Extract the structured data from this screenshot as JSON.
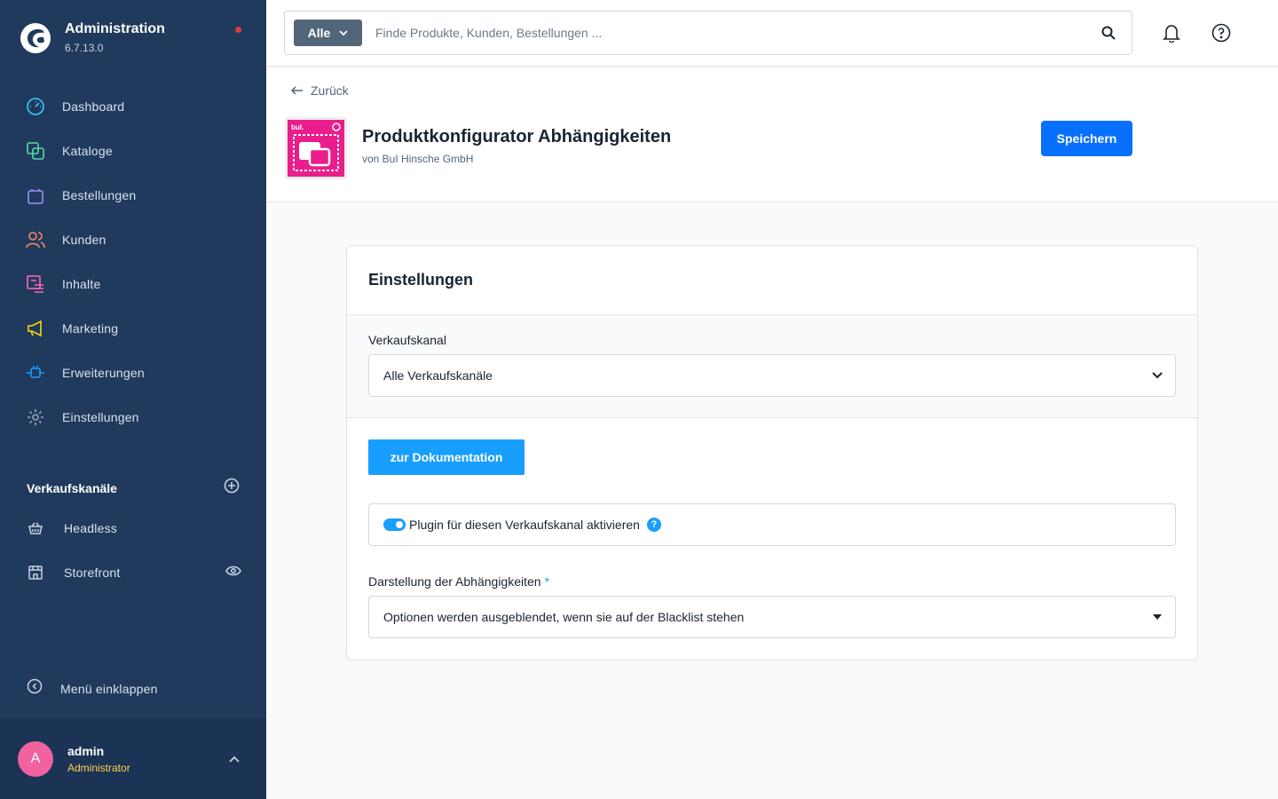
{
  "sidebar": {
    "brand_title": "Administration",
    "brand_version": "6.7.13.0",
    "nav": [
      {
        "label": "Dashboard",
        "icon": "dashboard-icon",
        "color": "#3ec8ff"
      },
      {
        "label": "Kataloge",
        "icon": "catalog-icon",
        "color": "#57d9a3"
      },
      {
        "label": "Bestellungen",
        "icon": "shopping-bag-icon",
        "color": "#a092f0"
      },
      {
        "label": "Kunden",
        "icon": "users-icon",
        "color": "#f88962"
      },
      {
        "label": "Inhalte",
        "icon": "content-icon",
        "color": "#ff68b4"
      },
      {
        "label": "Marketing",
        "icon": "megaphone-icon",
        "color": "#ffd700"
      },
      {
        "label": "Erweiterungen",
        "icon": "plug-icon",
        "color": "#189eff"
      },
      {
        "label": "Einstellungen",
        "icon": "gear-icon",
        "color": "#9aa8b5"
      }
    ],
    "sales_channels_title": "Verkaufskanäle",
    "sales_channels": [
      {
        "label": "Headless",
        "icon": "basket-icon"
      },
      {
        "label": "Storefront",
        "icon": "storefront-icon"
      }
    ],
    "collapse_label": "Menü einklappen",
    "user_initial": "A",
    "user_name": "admin",
    "user_role": "Administrator"
  },
  "topbar": {
    "search_type": "Alle",
    "search_placeholder": "Finde Produkte, Kunden, Bestellungen ..."
  },
  "header": {
    "back_label": "Zurück",
    "plugin_title": "Produktkonfigurator Abhängigkeiten",
    "plugin_vendor": "von BuI Hinsche GmbH",
    "plugin_logo_text": "buI.",
    "save_label": "Speichern"
  },
  "card": {
    "title": "Einstellungen",
    "sales_channel_label": "Verkaufskanal",
    "sales_channel_value": "Alle Verkaufskanäle",
    "doc_button": "zur Dokumentation",
    "toggle_label": "Plugin für diesen Verkaufskanal aktivieren",
    "toggle_on": true,
    "display_label": "Darstellung der Abhängigkeiten",
    "required_mark": "*",
    "display_value": "Optionen werden ausgeblendet, wenn sie auf der Blacklist stehen"
  },
  "colors": {
    "sidebar_bg": "#203a5e",
    "primary": "#0870ff",
    "accent": "#189eff",
    "plugin_brand": "#e91e8c"
  }
}
